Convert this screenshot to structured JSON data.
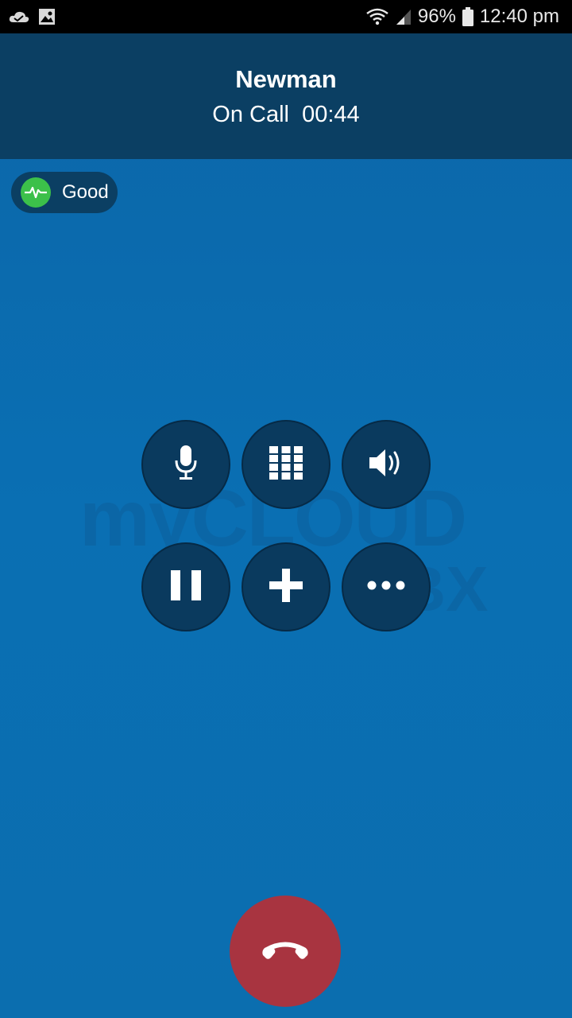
{
  "status_bar": {
    "left_icons": [
      "cloud-icon",
      "image-icon"
    ],
    "battery": "96%",
    "time": "12:40 pm",
    "right_icons": [
      "wifi-icon",
      "signal-icon",
      "battery-icon"
    ]
  },
  "call": {
    "name": "Newman",
    "status": "On Call  00:44"
  },
  "quality": {
    "label": "Good",
    "icon": "pulse-icon",
    "color": "#3cc04a"
  },
  "watermark": {
    "main": "myCLOUD",
    "sub": "PBX"
  },
  "controls": [
    {
      "name": "mute-button",
      "icon": "microphone-icon"
    },
    {
      "name": "keypad-button",
      "icon": "keypad-icon"
    },
    {
      "name": "speaker-button",
      "icon": "speaker-icon"
    },
    {
      "name": "hold-button",
      "icon": "pause-icon"
    },
    {
      "name": "add-call-button",
      "icon": "plus-icon"
    },
    {
      "name": "more-button",
      "icon": "more-icon"
    }
  ],
  "end_call": {
    "icon": "hang-up-icon",
    "color": "#a83440"
  }
}
